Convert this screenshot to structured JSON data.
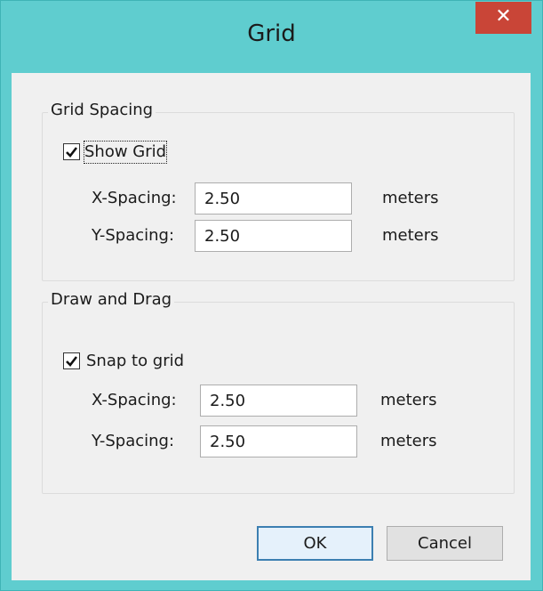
{
  "window": {
    "title": "Grid",
    "close_glyph": "✕"
  },
  "groups": [
    {
      "title": "Grid Spacing",
      "checkbox": {
        "label": "Show Grid",
        "checked": true
      },
      "x": {
        "label": "X-Spacing:",
        "value": "2.50",
        "unit": "meters"
      },
      "y": {
        "label": "Y-Spacing:",
        "value": "2.50",
        "unit": "meters"
      }
    },
    {
      "title": "Draw and Drag",
      "checkbox": {
        "label": "Snap to grid",
        "checked": true
      },
      "x": {
        "label": "X-Spacing:",
        "value": "2.50",
        "unit": "meters"
      },
      "y": {
        "label": "Y-Spacing:",
        "value": "2.50",
        "unit": "meters"
      }
    }
  ],
  "buttons": {
    "ok": "OK",
    "cancel": "Cancel"
  },
  "colors": {
    "titlebar": "#5fcdcf",
    "close": "#c94537",
    "client": "#f0f0f0",
    "ok_border": "#3c7fb1"
  }
}
